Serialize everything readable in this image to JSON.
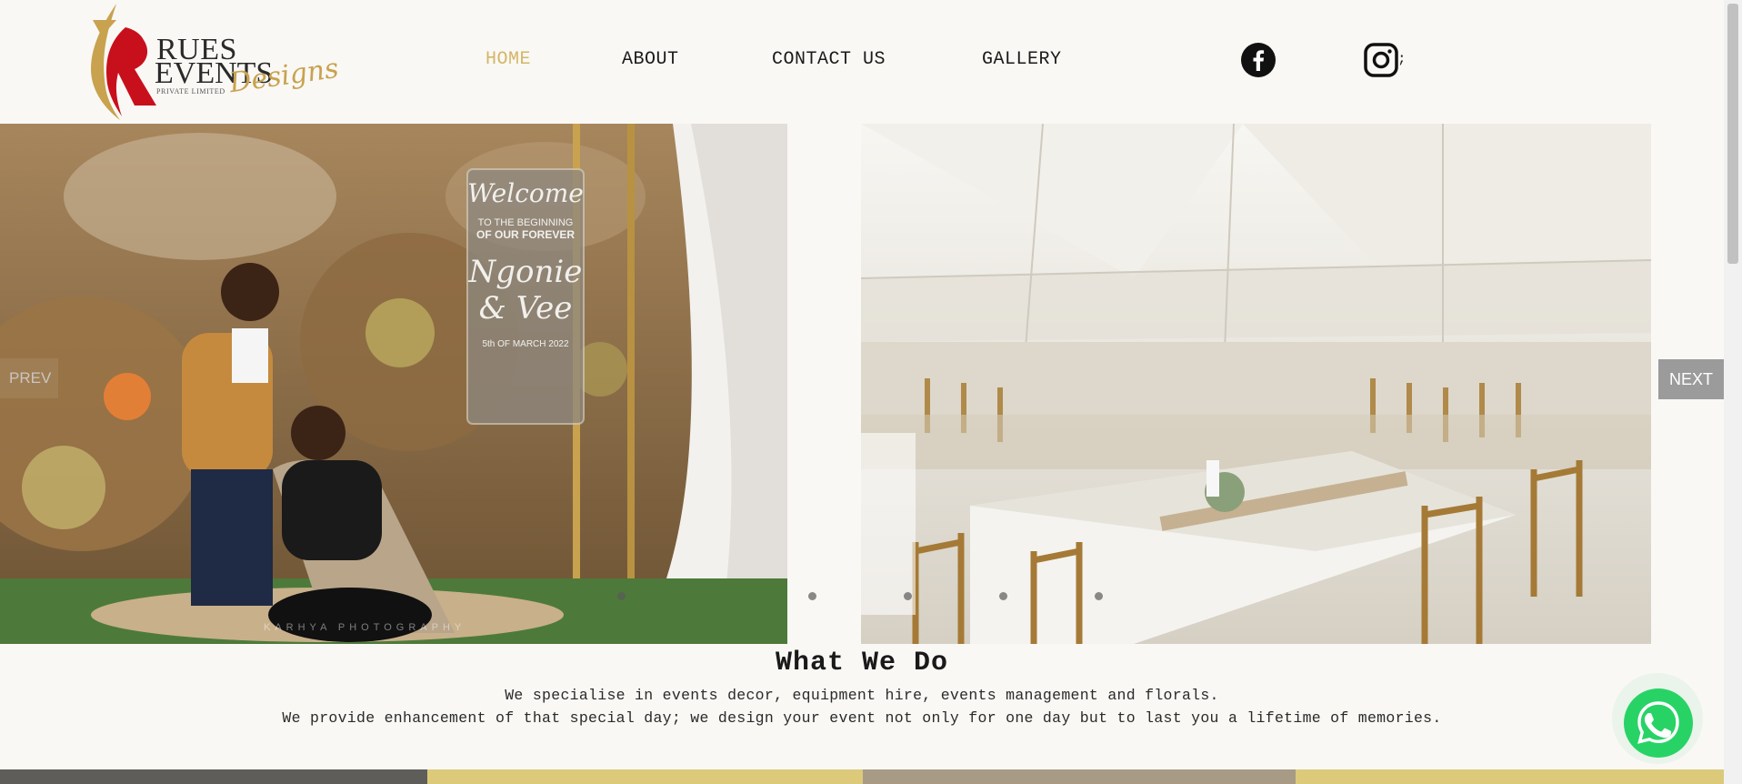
{
  "brand": {
    "line1": "RUES",
    "line2": "EVENTS",
    "tagline": "PRIVATE LIMITED",
    "script": "Designs",
    "colors": {
      "red": "#c8101c",
      "gold": "#c8a24e"
    }
  },
  "nav": {
    "items": [
      {
        "label": "HOME",
        "active": true
      },
      {
        "label": "ABOUT",
        "active": false
      },
      {
        "label": "CONTACT US",
        "active": false
      },
      {
        "label": "GALLERY",
        "active": false
      }
    ],
    "active_color": "#d4b666",
    "social": [
      {
        "icon": "facebook-icon"
      },
      {
        "icon": "instagram-icon"
      }
    ],
    "trailing": ";"
  },
  "slider": {
    "prev_label": "PREV",
    "next_label": "NEXT",
    "slides": [
      {
        "sign": {
          "title": "Welcome",
          "line1": "TO THE BEGINNING",
          "line2": "OF OUR FOREVER",
          "names1": "Ngonie",
          "names2": "& Vee",
          "date": "5th OF MARCH 2022"
        },
        "watermark": "KARHYA PHOTOGRAPHY"
      },
      {
        "description": "marquee-tent-reception"
      }
    ],
    "dots": 6,
    "active_dot": 2
  },
  "what_we_do": {
    "title": "What We Do",
    "line1": "We specialise in events decor, equipment hire, events management and florals.",
    "line2": "We provide enhancement of that special day; we design your event not only for one day but to last you a lifetime of memories."
  },
  "whatsapp": {
    "icon": "whatsapp-icon",
    "color": "#28d366"
  }
}
